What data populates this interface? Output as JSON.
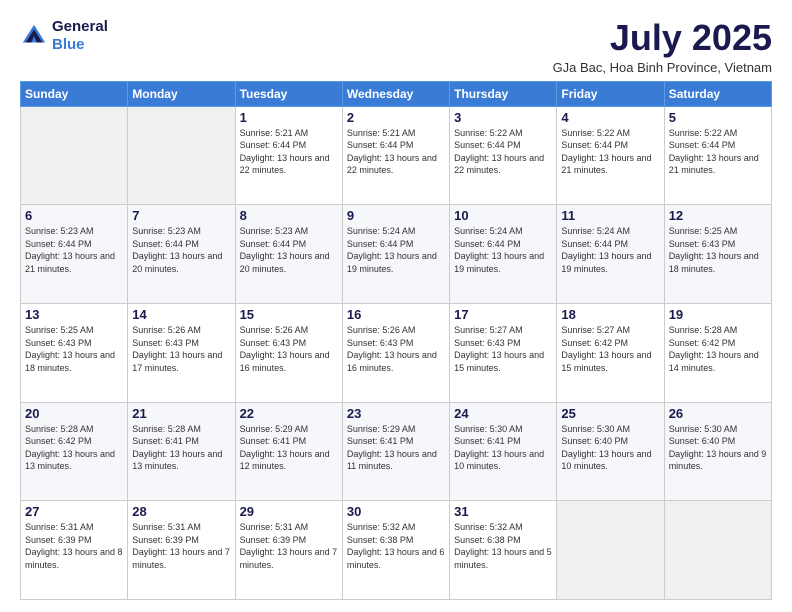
{
  "header": {
    "logo_line1": "General",
    "logo_line2": "Blue",
    "title": "July 2025",
    "subtitle": "GJa Bac, Hoa Binh Province, Vietnam"
  },
  "weekdays": [
    "Sunday",
    "Monday",
    "Tuesday",
    "Wednesday",
    "Thursday",
    "Friday",
    "Saturday"
  ],
  "weeks": [
    [
      {
        "day": "",
        "detail": ""
      },
      {
        "day": "",
        "detail": ""
      },
      {
        "day": "1",
        "detail": "Sunrise: 5:21 AM\nSunset: 6:44 PM\nDaylight: 13 hours\nand 22 minutes."
      },
      {
        "day": "2",
        "detail": "Sunrise: 5:21 AM\nSunset: 6:44 PM\nDaylight: 13 hours\nand 22 minutes."
      },
      {
        "day": "3",
        "detail": "Sunrise: 5:22 AM\nSunset: 6:44 PM\nDaylight: 13 hours\nand 22 minutes."
      },
      {
        "day": "4",
        "detail": "Sunrise: 5:22 AM\nSunset: 6:44 PM\nDaylight: 13 hours\nand 21 minutes."
      },
      {
        "day": "5",
        "detail": "Sunrise: 5:22 AM\nSunset: 6:44 PM\nDaylight: 13 hours\nand 21 minutes."
      }
    ],
    [
      {
        "day": "6",
        "detail": "Sunrise: 5:23 AM\nSunset: 6:44 PM\nDaylight: 13 hours\nand 21 minutes."
      },
      {
        "day": "7",
        "detail": "Sunrise: 5:23 AM\nSunset: 6:44 PM\nDaylight: 13 hours\nand 20 minutes."
      },
      {
        "day": "8",
        "detail": "Sunrise: 5:23 AM\nSunset: 6:44 PM\nDaylight: 13 hours\nand 20 minutes."
      },
      {
        "day": "9",
        "detail": "Sunrise: 5:24 AM\nSunset: 6:44 PM\nDaylight: 13 hours\nand 19 minutes."
      },
      {
        "day": "10",
        "detail": "Sunrise: 5:24 AM\nSunset: 6:44 PM\nDaylight: 13 hours\nand 19 minutes."
      },
      {
        "day": "11",
        "detail": "Sunrise: 5:24 AM\nSunset: 6:44 PM\nDaylight: 13 hours\nand 19 minutes."
      },
      {
        "day": "12",
        "detail": "Sunrise: 5:25 AM\nSunset: 6:43 PM\nDaylight: 13 hours\nand 18 minutes."
      }
    ],
    [
      {
        "day": "13",
        "detail": "Sunrise: 5:25 AM\nSunset: 6:43 PM\nDaylight: 13 hours\nand 18 minutes."
      },
      {
        "day": "14",
        "detail": "Sunrise: 5:26 AM\nSunset: 6:43 PM\nDaylight: 13 hours\nand 17 minutes."
      },
      {
        "day": "15",
        "detail": "Sunrise: 5:26 AM\nSunset: 6:43 PM\nDaylight: 13 hours\nand 16 minutes."
      },
      {
        "day": "16",
        "detail": "Sunrise: 5:26 AM\nSunset: 6:43 PM\nDaylight: 13 hours\nand 16 minutes."
      },
      {
        "day": "17",
        "detail": "Sunrise: 5:27 AM\nSunset: 6:43 PM\nDaylight: 13 hours\nand 15 minutes."
      },
      {
        "day": "18",
        "detail": "Sunrise: 5:27 AM\nSunset: 6:42 PM\nDaylight: 13 hours\nand 15 minutes."
      },
      {
        "day": "19",
        "detail": "Sunrise: 5:28 AM\nSunset: 6:42 PM\nDaylight: 13 hours\nand 14 minutes."
      }
    ],
    [
      {
        "day": "20",
        "detail": "Sunrise: 5:28 AM\nSunset: 6:42 PM\nDaylight: 13 hours\nand 13 minutes."
      },
      {
        "day": "21",
        "detail": "Sunrise: 5:28 AM\nSunset: 6:41 PM\nDaylight: 13 hours\nand 13 minutes."
      },
      {
        "day": "22",
        "detail": "Sunrise: 5:29 AM\nSunset: 6:41 PM\nDaylight: 13 hours\nand 12 minutes."
      },
      {
        "day": "23",
        "detail": "Sunrise: 5:29 AM\nSunset: 6:41 PM\nDaylight: 13 hours\nand 11 minutes."
      },
      {
        "day": "24",
        "detail": "Sunrise: 5:30 AM\nSunset: 6:41 PM\nDaylight: 13 hours\nand 10 minutes."
      },
      {
        "day": "25",
        "detail": "Sunrise: 5:30 AM\nSunset: 6:40 PM\nDaylight: 13 hours\nand 10 minutes."
      },
      {
        "day": "26",
        "detail": "Sunrise: 5:30 AM\nSunset: 6:40 PM\nDaylight: 13 hours\nand 9 minutes."
      }
    ],
    [
      {
        "day": "27",
        "detail": "Sunrise: 5:31 AM\nSunset: 6:39 PM\nDaylight: 13 hours\nand 8 minutes."
      },
      {
        "day": "28",
        "detail": "Sunrise: 5:31 AM\nSunset: 6:39 PM\nDaylight: 13 hours\nand 7 minutes."
      },
      {
        "day": "29",
        "detail": "Sunrise: 5:31 AM\nSunset: 6:39 PM\nDaylight: 13 hours\nand 7 minutes."
      },
      {
        "day": "30",
        "detail": "Sunrise: 5:32 AM\nSunset: 6:38 PM\nDaylight: 13 hours\nand 6 minutes."
      },
      {
        "day": "31",
        "detail": "Sunrise: 5:32 AM\nSunset: 6:38 PM\nDaylight: 13 hours\nand 5 minutes."
      },
      {
        "day": "",
        "detail": ""
      },
      {
        "day": "",
        "detail": ""
      }
    ]
  ]
}
